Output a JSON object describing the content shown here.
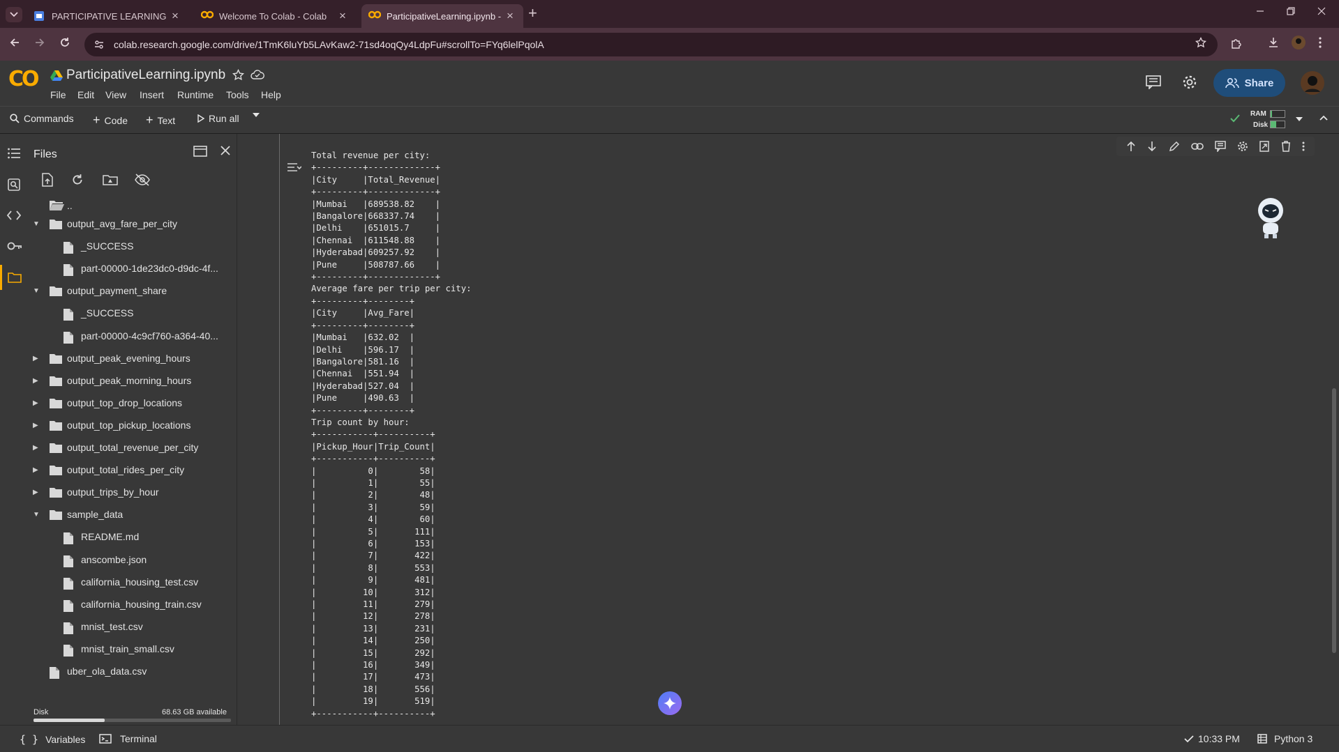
{
  "browser": {
    "tabs": [
      {
        "title": "PARTICIPATIVE LEARNING",
        "favicon": "slides-icon"
      },
      {
        "title": "Welcome To Colab - Colab",
        "favicon": "colab-icon"
      },
      {
        "title": "ParticipativeLearning.ipynb - Colab",
        "favicon": "colab-icon"
      }
    ],
    "active_tab": 2,
    "url": "colab.research.google.com/drive/1TmK6luYb5LAvKaw2-71sd4oqQy4LdpFu#scrollTo=FYq6lelPqolA"
  },
  "notebook": {
    "logo": "CO",
    "title": "ParticipativeLearning.ipynb",
    "menu": [
      "File",
      "Edit",
      "View",
      "Insert",
      "Runtime",
      "Tools",
      "Help"
    ],
    "share_label": "Share"
  },
  "toolbar": {
    "commands": "Commands",
    "code": "Code",
    "text": "Text",
    "run_all": "Run all",
    "ram": "RAM",
    "disk": "Disk"
  },
  "files_panel": {
    "title": "Files",
    "parent": "..",
    "tree": [
      {
        "name": "output_avg_fare_per_city",
        "type": "folder",
        "expanded": true,
        "depth": 0
      },
      {
        "name": "_SUCCESS",
        "type": "file",
        "depth": 1
      },
      {
        "name": "part-00000-1de23dc0-d9dc-4f...",
        "type": "file",
        "depth": 1
      },
      {
        "name": "output_payment_share",
        "type": "folder",
        "expanded": true,
        "depth": 0
      },
      {
        "name": "_SUCCESS",
        "type": "file",
        "depth": 1
      },
      {
        "name": "part-00000-4c9cf760-a364-40...",
        "type": "file",
        "depth": 1
      },
      {
        "name": "output_peak_evening_hours",
        "type": "folder",
        "expanded": false,
        "depth": 0
      },
      {
        "name": "output_peak_morning_hours",
        "type": "folder",
        "expanded": false,
        "depth": 0
      },
      {
        "name": "output_top_drop_locations",
        "type": "folder",
        "expanded": false,
        "depth": 0
      },
      {
        "name": "output_top_pickup_locations",
        "type": "folder",
        "expanded": false,
        "depth": 0
      },
      {
        "name": "output_total_revenue_per_city",
        "type": "folder",
        "expanded": false,
        "depth": 0
      },
      {
        "name": "output_total_rides_per_city",
        "type": "folder",
        "expanded": false,
        "depth": 0
      },
      {
        "name": "output_trips_by_hour",
        "type": "folder",
        "expanded": false,
        "depth": 0
      },
      {
        "name": "sample_data",
        "type": "folder",
        "expanded": true,
        "depth": 0
      },
      {
        "name": "README.md",
        "type": "file",
        "depth": 1
      },
      {
        "name": "anscombe.json",
        "type": "file",
        "depth": 1
      },
      {
        "name": "california_housing_test.csv",
        "type": "file",
        "depth": 1
      },
      {
        "name": "california_housing_train.csv",
        "type": "file",
        "depth": 1
      },
      {
        "name": "mnist_test.csv",
        "type": "file",
        "depth": 1
      },
      {
        "name": "mnist_train_small.csv",
        "type": "file",
        "depth": 1
      },
      {
        "name": "uber_ola_data.csv",
        "type": "file",
        "depth": 0
      }
    ],
    "disk_label": "Disk",
    "disk_available": "68.63 GB available",
    "disk_used_fraction": 0.36
  },
  "output": {
    "revenue_heading": "Total revenue per city:",
    "revenue_columns": [
      "City",
      "Total_Revenue"
    ],
    "revenue_rows": [
      [
        "Mumbai",
        "689538.82"
      ],
      [
        "Bangalore",
        "668337.74"
      ],
      [
        "Delhi",
        "651015.7"
      ],
      [
        "Chennai",
        "611548.88"
      ],
      [
        "Hyderabad",
        "609257.92"
      ],
      [
        "Pune",
        "508787.66"
      ]
    ],
    "fare_heading": "Average fare per trip per city:",
    "fare_columns": [
      "City",
      "Avg_Fare"
    ],
    "fare_rows": [
      [
        "Mumbai",
        "632.02"
      ],
      [
        "Delhi",
        "596.17"
      ],
      [
        "Bangalore",
        "581.16"
      ],
      [
        "Chennai",
        "551.94"
      ],
      [
        "Hyderabad",
        "527.04"
      ],
      [
        "Pune",
        "490.63"
      ]
    ],
    "trip_heading": "Trip count by hour:",
    "trip_columns": [
      "Pickup_Hour",
      "Trip_Count"
    ],
    "trip_rows": [
      [
        "0",
        "58"
      ],
      [
        "1",
        "55"
      ],
      [
        "2",
        "48"
      ],
      [
        "3",
        "59"
      ],
      [
        "4",
        "60"
      ],
      [
        "5",
        "111"
      ],
      [
        "6",
        "153"
      ],
      [
        "7",
        "422"
      ],
      [
        "8",
        "553"
      ],
      [
        "9",
        "481"
      ],
      [
        "10",
        "312"
      ],
      [
        "11",
        "279"
      ],
      [
        "12",
        "278"
      ],
      [
        "13",
        "231"
      ],
      [
        "14",
        "250"
      ],
      [
        "15",
        "292"
      ],
      [
        "16",
        "349"
      ],
      [
        "17",
        "473"
      ],
      [
        "18",
        "556"
      ],
      [
        "19",
        "519"
      ]
    ]
  },
  "statusbar": {
    "variables": "Variables",
    "terminal": "Terminal",
    "time": "10:33 PM",
    "kernel": "Python 3"
  }
}
